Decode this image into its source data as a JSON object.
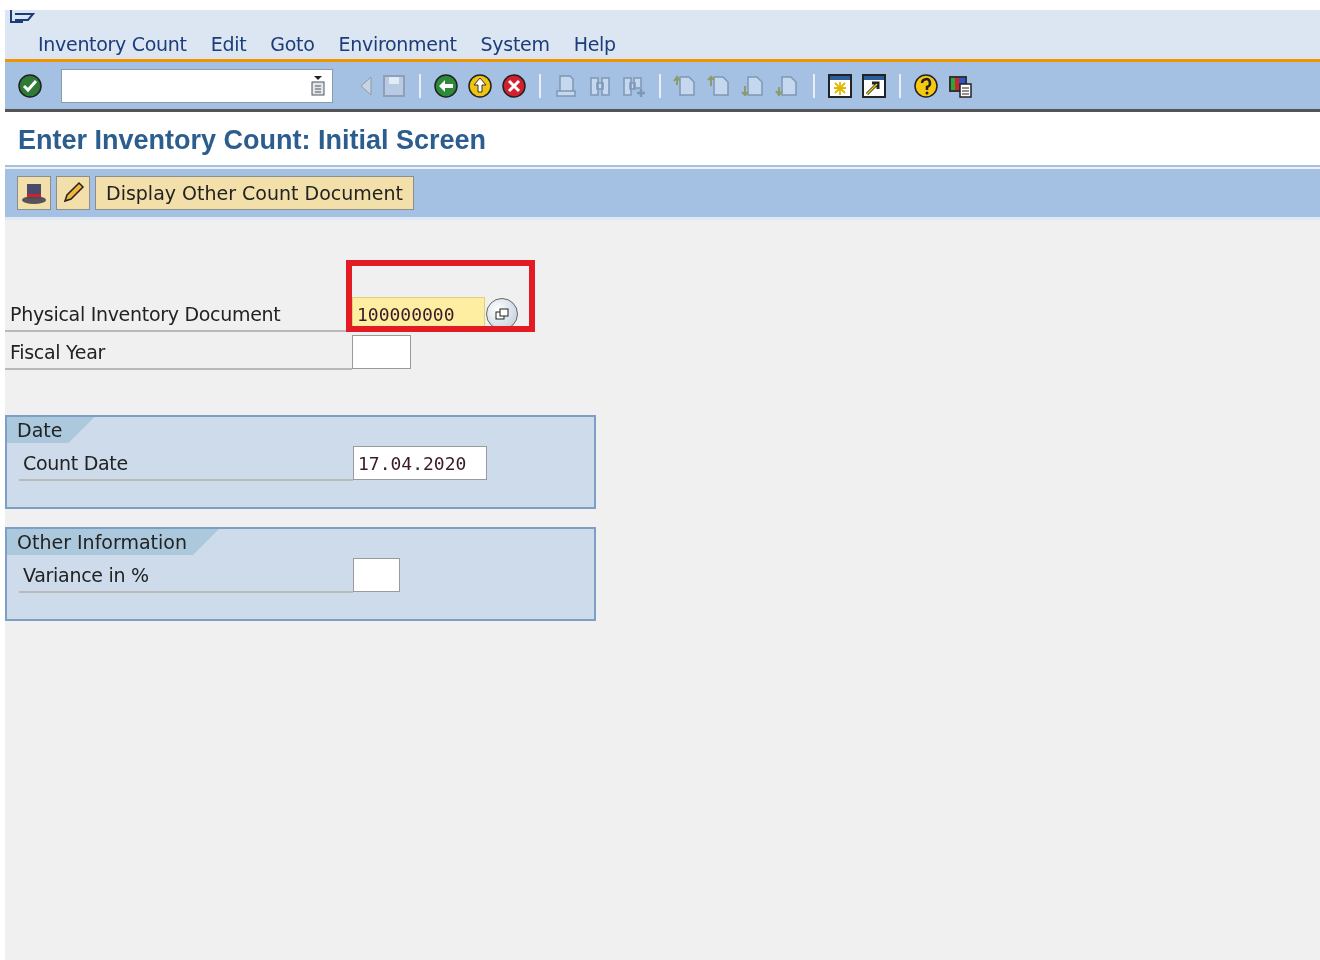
{
  "menu": [
    {
      "label": "Inventory Count"
    },
    {
      "label": "Edit"
    },
    {
      "label": "Goto"
    },
    {
      "label": "Environment"
    },
    {
      "label": "System"
    },
    {
      "label": "Help"
    }
  ],
  "title": "Enter Inventory Count: Initial Screen",
  "app_toolbar": {
    "button": "Display Other Count Document"
  },
  "fields": [
    {
      "label": "Physical Inventory Document",
      "value": "100000000",
      "required": true,
      "highlighted": true,
      "help": true
    },
    {
      "label": "Fiscal Year",
      "required": false,
      "highlighted": false,
      "help": false
    }
  ],
  "groups": [
    {
      "title": "Date",
      "fields": [
        {
          "label": "Count Date",
          "value": "17.04.2020"
        }
      ]
    },
    {
      "title": "Other Information",
      "fields": [
        {
          "label": "Variance in %"
        }
      ]
    }
  ]
}
